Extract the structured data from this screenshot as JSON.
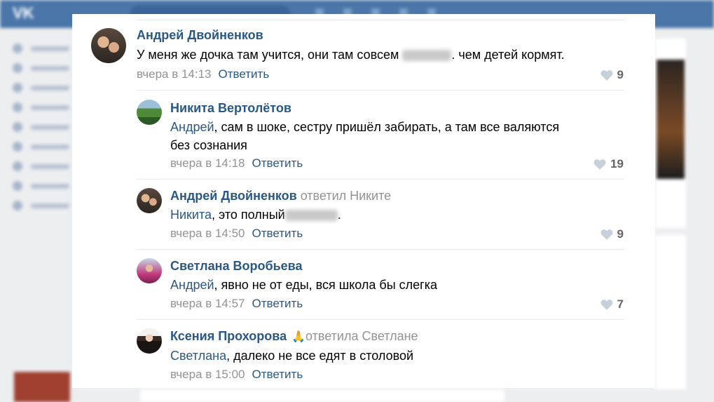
{
  "header": {
    "logo": "VK"
  },
  "comments": [
    {
      "author": "Андрей Двойненков",
      "text_before": "У меня же дочка там учится, они там совсем ",
      "text_after": ". чем детей кормят.",
      "time": "вчера в 14:13",
      "reply_label": "Ответить",
      "likes": "9"
    },
    {
      "author": "Никита Вертолётов",
      "mention": "Андрей",
      "text_line1": ", сам в шоке, сестру пришёл забирать, а там все валяются",
      "text_line2": "без сознания",
      "time": "вчера в 14:18",
      "reply_label": "Ответить",
      "likes": "19"
    },
    {
      "author": "Андрей Двойненков",
      "reply_to": "ответил Никите",
      "mention": "Никита",
      "text": ", это полный",
      "text_after": ".",
      "time": "вчера в 14:50",
      "reply_label": "Ответить",
      "likes": "9"
    },
    {
      "author": "Светлана Воробьева",
      "mention": "Андрей",
      "text": ", явно не от еды, вся школа бы слегка",
      "time": "вчера в 14:57",
      "reply_label": "Ответить",
      "likes": "7"
    },
    {
      "author": "Ксения Прохорова",
      "emoji": "🙏",
      "reply_to": "ответила Светлане",
      "mention": "Светлана",
      "text": ", далеко не все едят в столовой",
      "time": "вчера в 15:00",
      "reply_label": "Ответить"
    }
  ],
  "colors": {
    "link": "#2a5885",
    "muted": "#939393",
    "header": "#4a76a8"
  }
}
